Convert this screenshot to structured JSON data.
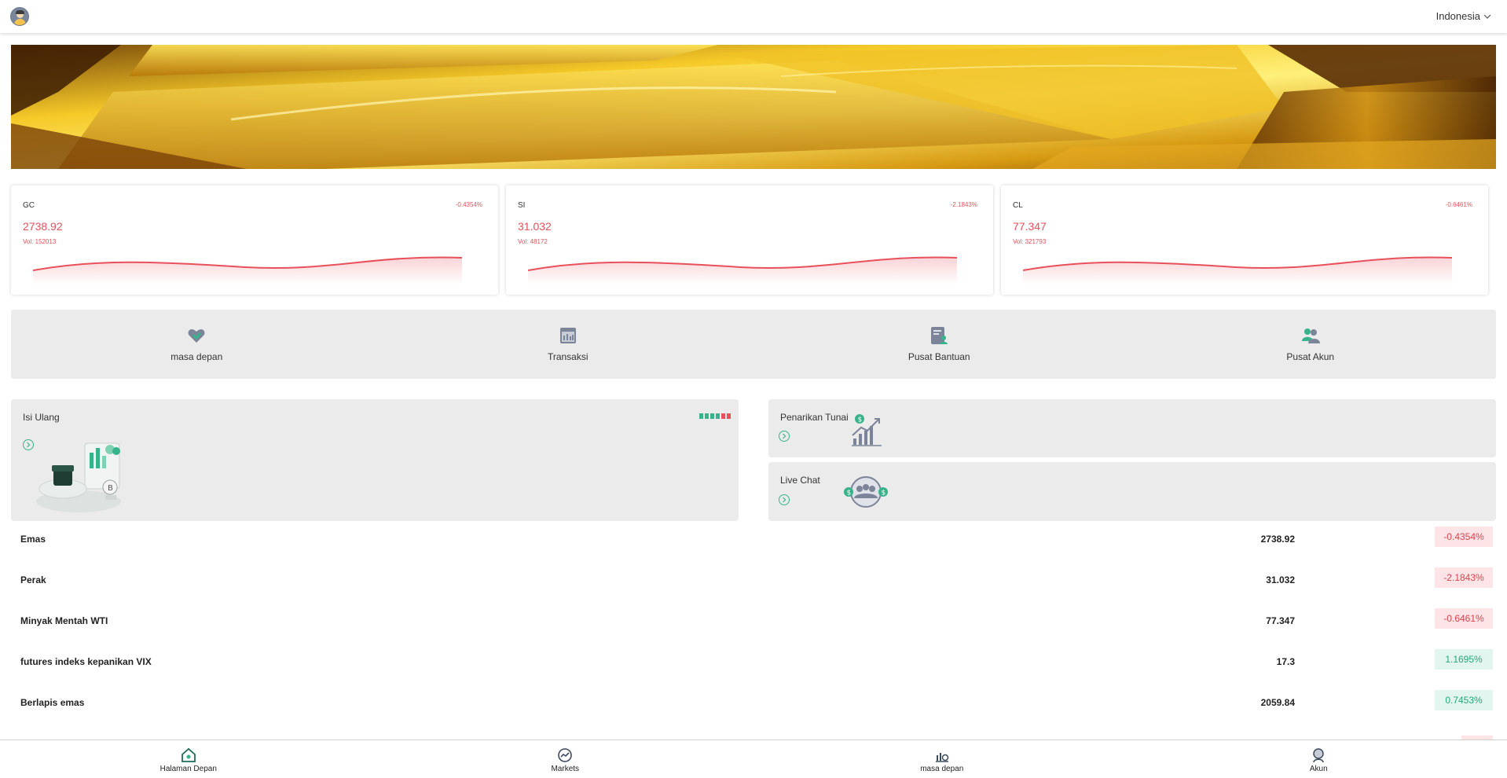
{
  "header": {
    "language": "Indonesia"
  },
  "tickers": [
    {
      "symbol": "GC",
      "change": "-0.4354%",
      "price": "2738.92",
      "volume": "Vol: 152013"
    },
    {
      "symbol": "SI",
      "change": "-2.1843%",
      "price": "31.032",
      "volume": "Vol: 48172"
    },
    {
      "symbol": "CL",
      "change": "-0.6461%",
      "price": "77.347",
      "volume": "Vol: 321793"
    }
  ],
  "quick_menu": [
    {
      "label": "masa depan",
      "icon": "handshake-heart-icon"
    },
    {
      "label": "Transaksi",
      "icon": "calendar-chart-icon"
    },
    {
      "label": "Pusat Bantuan",
      "icon": "document-user-icon"
    },
    {
      "label": "Pusat Akun",
      "icon": "users-icon"
    }
  ],
  "promo": {
    "topup": {
      "title": "Isi Ulang"
    },
    "withdraw": {
      "title": "Penarikan Tunai"
    },
    "chat": {
      "title": "Live Chat"
    }
  },
  "markets": [
    {
      "name": "Emas",
      "price": "2738.92",
      "change": "-0.4354%",
      "direction": "down"
    },
    {
      "name": "Perak",
      "price": "31.032",
      "change": "-2.1843%",
      "direction": "down"
    },
    {
      "name": "Minyak Mentah WTI",
      "price": "77.347",
      "change": "-0.6461%",
      "direction": "down"
    },
    {
      "name": "futures indeks kepanikan VIX",
      "price": "17.3",
      "change": "1.1695%",
      "direction": "up"
    },
    {
      "name": "Berlapis emas",
      "price": "2059.84",
      "change": "0.7453%",
      "direction": "up"
    }
  ],
  "bottom_nav": [
    {
      "label": "Halaman Depan",
      "icon": "home-icon"
    },
    {
      "label": "Markets",
      "icon": "markets-icon"
    },
    {
      "label": "masa depan",
      "icon": "futures-icon"
    },
    {
      "label": "Akun",
      "icon": "account-icon"
    }
  ],
  "colors": {
    "down": "#e8505b",
    "up": "#24a77b",
    "accent": "#37b38b",
    "card_bg": "#ebebeb"
  }
}
